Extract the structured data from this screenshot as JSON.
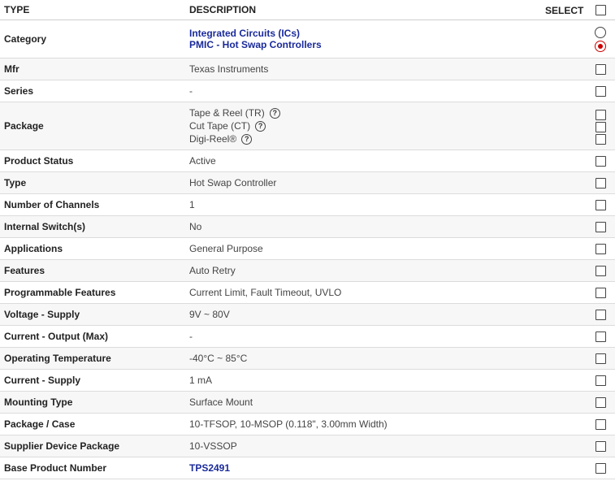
{
  "header": {
    "type": "TYPE",
    "description": "DESCRIPTION",
    "select": "SELECT"
  },
  "category": {
    "label": "Category",
    "links": [
      "Integrated Circuits (ICs)",
      "PMIC - Hot Swap Controllers"
    ]
  },
  "package": {
    "label": "Package",
    "options": [
      "Tape & Reel (TR)",
      "Cut Tape (CT)",
      "Digi-Reel®"
    ],
    "help_icon": "question-circle-icon"
  },
  "rows": [
    {
      "label": "Mfr",
      "value": "Texas Instruments"
    },
    {
      "label": "Series",
      "value": "-"
    },
    {
      "label": "Product Status",
      "value": "Active"
    },
    {
      "label": "Type",
      "value": "Hot Swap Controller"
    },
    {
      "label": "Number of Channels",
      "value": "1"
    },
    {
      "label": "Internal Switch(s)",
      "value": "No"
    },
    {
      "label": "Applications",
      "value": "General Purpose"
    },
    {
      "label": "Features",
      "value": "Auto Retry"
    },
    {
      "label": "Programmable Features",
      "value": "Current Limit, Fault Timeout, UVLO"
    },
    {
      "label": "Voltage - Supply",
      "value": "9V ~ 80V"
    },
    {
      "label": "Current - Output (Max)",
      "value": "-"
    },
    {
      "label": "Operating Temperature",
      "value": "-40°C ~ 85°C"
    },
    {
      "label": "Current - Supply",
      "value": "1 mA"
    },
    {
      "label": "Mounting Type",
      "value": "Surface Mount"
    },
    {
      "label": "Package / Case",
      "value": "10-TFSOP, 10-MSOP (0.118\", 3.00mm Width)"
    },
    {
      "label": "Supplier Device Package",
      "value": "10-VSSOP"
    },
    {
      "label": "Base Product Number",
      "value": "TPS2491"
    }
  ],
  "colors": {
    "link": "#1a2a9a",
    "radio_selected": "#cc0000",
    "alt_row": "#f7f7f7",
    "border": "#dcdcdc"
  }
}
